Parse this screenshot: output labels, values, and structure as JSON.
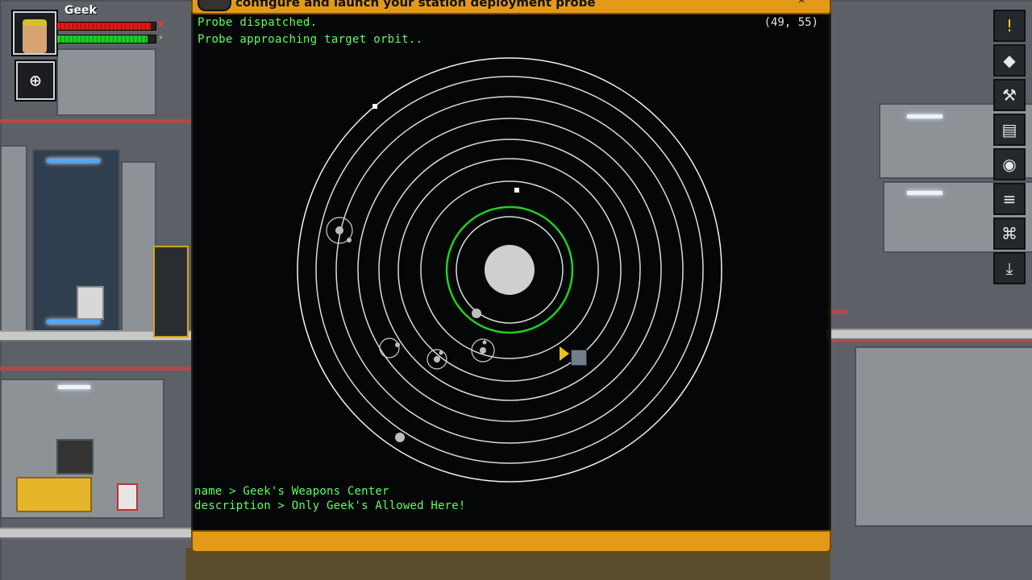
{
  "player": {
    "name": "Geek",
    "health_fraction": 0.95,
    "energy_fraction": 0.92
  },
  "window": {
    "title": "configure and launch your station deployment probe",
    "coordinates": "(49, 55)",
    "log": [
      "Probe dispatched.",
      "Probe approaching target orbit.."
    ],
    "info": {
      "name_line": "name > Geek's Weapons Center",
      "description_line": "description > Only Geek's Allowed Here!"
    }
  },
  "sidebar": {
    "buttons": [
      {
        "name": "quest-log-icon",
        "glyph": "!"
      },
      {
        "name": "inventory-icon",
        "glyph": "◆"
      },
      {
        "name": "crafting-icon",
        "glyph": "⚒"
      },
      {
        "name": "codex-icon",
        "glyph": "▤"
      },
      {
        "name": "tech-icon",
        "glyph": "◉"
      },
      {
        "name": "menu-icon",
        "glyph": "≡"
      },
      {
        "name": "collections-icon",
        "glyph": "⌘"
      },
      {
        "name": "beam-down-icon",
        "glyph": "⤓"
      }
    ]
  },
  "colors": {
    "log_text": "#5dff5d",
    "window_frame": "#e39a18",
    "target_orbit": "#1fd11f",
    "orbit": "#d9d9d9"
  }
}
